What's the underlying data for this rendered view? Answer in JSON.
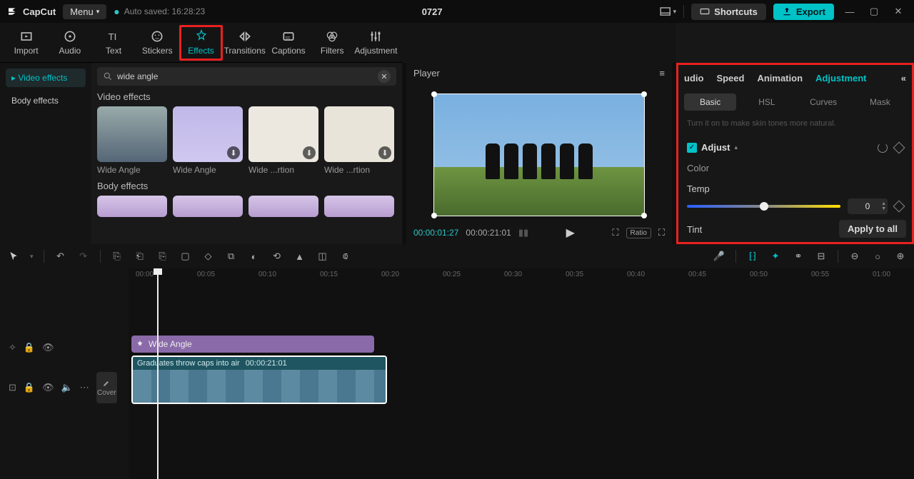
{
  "topbar": {
    "app_name": "CapCut",
    "menu_label": "Menu",
    "autosaved_label": "Auto saved: 16:28:23",
    "project_title": "0727",
    "shortcuts_label": "Shortcuts",
    "export_label": "Export"
  },
  "media_tabs": {
    "import": "Import",
    "audio": "Audio",
    "text": "Text",
    "stickers": "Stickers",
    "effects": "Effects",
    "transitions": "Transitions",
    "captions": "Captions",
    "filters": "Filters",
    "adjustment": "Adjustment"
  },
  "effects_panel": {
    "side_video": "Video effects",
    "side_body": "Body effects",
    "search_value": "wide angle",
    "section_video": "Video effects",
    "section_body": "Body effects",
    "thumbs": [
      "Wide Angle",
      "Wide Angle",
      "Wide ...rtion",
      "Wide ...rtion"
    ]
  },
  "player": {
    "title": "Player",
    "time_current": "00:00:01:27",
    "time_total": "00:00:21:01",
    "ratio_label": "Ratio"
  },
  "inspector": {
    "tabs": {
      "audio": "udio",
      "speed": "Speed",
      "animation": "Animation",
      "adjustment": "Adjustment"
    },
    "subtabs": {
      "basic": "Basic",
      "hsl": "HSL",
      "curves": "Curves",
      "mask": "Mask"
    },
    "hint_line": "Turn it on to make skin tones more natural.",
    "adjust_label": "Adjust",
    "color_label": "Color",
    "temp_label": "Temp",
    "temp_value": "0",
    "tint_label": "Tint",
    "apply_all": "Apply to all"
  },
  "timeline": {
    "ruler": [
      "00:00",
      "00:05",
      "00:10",
      "00:15",
      "00:20",
      "00:25",
      "00:30",
      "00:35",
      "00:40",
      "00:45",
      "00:50",
      "00:55",
      "01:00"
    ],
    "fx_clip_label": "Wide Angle",
    "video_clip_label": "Graduates throw caps into air",
    "video_clip_time": "00:00:21:01",
    "cover_label": "Cover"
  }
}
